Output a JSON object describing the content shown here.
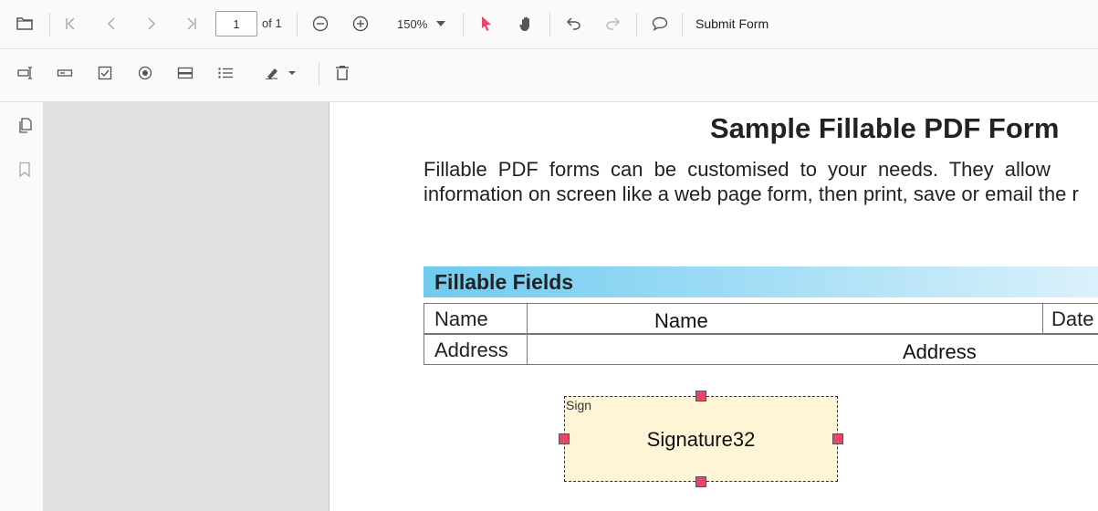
{
  "toolbar": {
    "open_icon": "folder-icon",
    "first_page_icon": "first-page-icon",
    "prev_page_icon": "previous-page-icon",
    "next_page_icon": "next-page-icon",
    "last_page_icon": "last-page-icon",
    "current_page": "1",
    "page_total_label": "of 1",
    "zoom_out_icon": "zoom-out-icon",
    "zoom_in_icon": "zoom-in-icon",
    "zoom_value": "150%",
    "select_tool_icon": "pointer-icon",
    "pan_tool_icon": "hand-icon",
    "undo_icon": "undo-icon",
    "redo_icon": "redo-icon",
    "comment_icon": "comment-icon",
    "submit_label": "Submit Form"
  },
  "form_toolbar": {
    "textbox_icon": "textbox-field-icon",
    "password_icon": "password-field-icon",
    "checkbox_icon": "checkbox-field-icon",
    "radio_icon": "radio-field-icon",
    "dropdown_icon": "dropdown-field-icon",
    "listbox_icon": "listbox-field-icon",
    "signature_icon": "signature-field-icon",
    "delete_icon": "delete-icon"
  },
  "sidebar": {
    "thumbnails_icon": "page-thumbnails-icon",
    "bookmarks_icon": "bookmark-icon"
  },
  "document": {
    "title": "Sample Fillable PDF Form",
    "paragraph_line1": "Fillable PDF forms can be customised to your needs. They allow",
    "paragraph_line2": "information on screen like a web page form, then print, save or email the r",
    "section_title": "Fillable Fields",
    "rows": [
      {
        "label": "Name",
        "field_value": "Name",
        "extra_label": "Date"
      },
      {
        "label": "Address",
        "field_value": "Address"
      }
    ],
    "signature": {
      "tag": "Sign",
      "value": "Signature32"
    }
  },
  "colors": {
    "accent": "#e9446a",
    "section_gradient_start": "#6fcbef",
    "signature_fill": "#fdf5d6",
    "viewer_background": "#e0e0e0"
  }
}
